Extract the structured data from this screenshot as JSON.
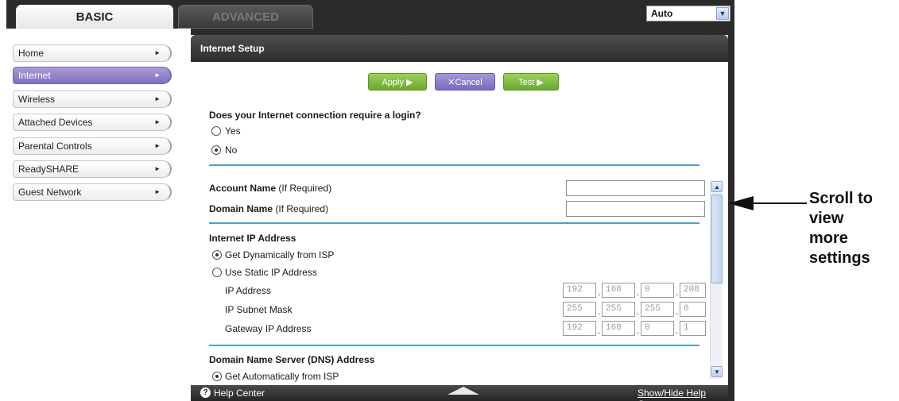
{
  "tabs": {
    "basic": "BASIC",
    "advanced": "ADVANCED"
  },
  "language_select": {
    "value": "Auto"
  },
  "sidebar": {
    "items": [
      {
        "label": "Home"
      },
      {
        "label": "Internet"
      },
      {
        "label": "Wireless"
      },
      {
        "label": "Attached Devices"
      },
      {
        "label": "Parental Controls"
      },
      {
        "label": "ReadySHARE"
      },
      {
        "label": "Guest Network"
      }
    ],
    "active_index": 1
  },
  "panel": {
    "title": "Internet Setup",
    "buttons": {
      "apply": "Apply ▶",
      "cancel": "✕Cancel",
      "test": "Test ▶"
    },
    "login_question": "Does your Internet connection require a login?",
    "login_options": {
      "yes": "Yes",
      "no": "No",
      "selected": "No"
    },
    "account_name_label": "Account Name",
    "domain_name_label": "Domain Name",
    "if_required": "(If Required)",
    "ip_section": {
      "heading": "Internet IP Address",
      "dynamic": "Get Dynamically from ISP",
      "static": "Use Static IP Address",
      "selected": "Get Dynamically from ISP",
      "ip_address_label": "IP Address",
      "ip_address": [
        "192",
        "168",
        "0",
        "208"
      ],
      "subnet_label": "IP Subnet Mask",
      "subnet": [
        "255",
        "255",
        "255",
        "0"
      ],
      "gateway_label": "Gateway IP Address",
      "gateway": [
        "192",
        "168",
        "0",
        "1"
      ]
    },
    "dns_section": {
      "heading": "Domain Name Server (DNS) Address",
      "auto": "Get Automatically from ISP"
    }
  },
  "footer": {
    "help": "Help Center",
    "toggle": "Show/Hide Help Center"
  },
  "callout": {
    "line1": "Scroll to",
    "line2": "view",
    "line3": "more",
    "line4": "settings"
  },
  "colors": {
    "accent_purple": "#8a7bc8",
    "accent_green": "#7ab83c",
    "rule_blue": "#4aa3c8"
  }
}
